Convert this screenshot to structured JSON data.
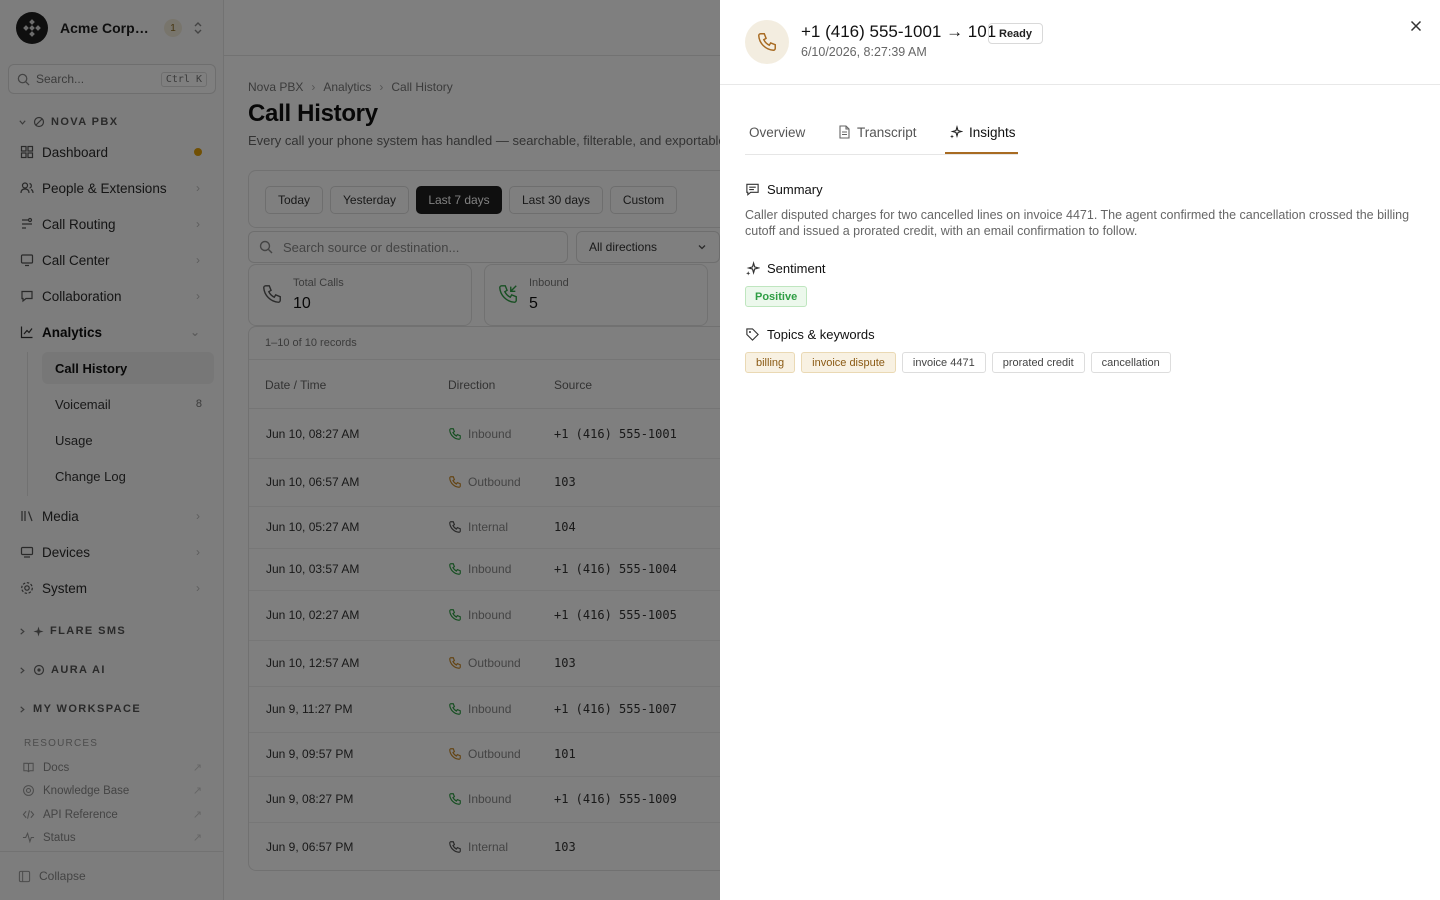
{
  "sidebar": {
    "org_name": "Acme Corporation",
    "org_badge": "1",
    "search_placeholder": "Search...",
    "search_shortcut": "Ctrl K",
    "section_nova": "NOVA PBX",
    "nav": {
      "dashboard": "Dashboard",
      "people": "People & Extensions",
      "routing": "Call Routing",
      "center": "Call Center",
      "collab": "Collaboration",
      "analytics": "Analytics",
      "media": "Media",
      "devices": "Devices",
      "system": "System"
    },
    "sub": {
      "history": "Call History",
      "voicemail": "Voicemail",
      "voicemail_count": "8",
      "usage": "Usage",
      "changelog": "Change Log"
    },
    "section_flare": "FLARE SMS",
    "section_aura": "AURA AI",
    "section_workspace": "MY WORKSPACE",
    "resources_head": "RESOURCES",
    "resources": {
      "docs": "Docs",
      "kb": "Knowledge Base",
      "api": "API Reference",
      "status": "Status"
    },
    "collapse": "Collapse"
  },
  "main": {
    "breadcrumb": [
      "Nova PBX",
      "Analytics",
      "Call History"
    ],
    "title": "Call History",
    "subtitle": "Every call your phone system has handled — searchable, filterable, and exportable.",
    "ranges": [
      "Today",
      "Yesterday",
      "Last 7 days",
      "Last 30 days",
      "Custom"
    ],
    "table_search_placeholder": "Search source or destination...",
    "direction_filter": "All directions",
    "stats": [
      {
        "label": "Total Calls",
        "value": "10"
      },
      {
        "label": "Inbound",
        "value": "5"
      }
    ],
    "records": "1–10 of 10 records",
    "columns": [
      "Date / Time",
      "Direction",
      "Source"
    ],
    "rows": [
      {
        "time": "Jun 10, 08:27 AM",
        "direction": "Inbound",
        "source": "+1 (416) 555-1001"
      },
      {
        "time": "Jun 10, 06:57 AM",
        "direction": "Outbound",
        "source": "103"
      },
      {
        "time": "Jun 10, 05:27 AM",
        "direction": "Internal",
        "source": "104"
      },
      {
        "time": "Jun 10, 03:57 AM",
        "direction": "Inbound",
        "source": "+1 (416) 555-1004"
      },
      {
        "time": "Jun 10, 02:27 AM",
        "direction": "Inbound",
        "source": "+1 (416) 555-1005"
      },
      {
        "time": "Jun 10, 12:57 AM",
        "direction": "Outbound",
        "source": "103"
      },
      {
        "time": "Jun 9, 11:27 PM",
        "direction": "Inbound",
        "source": "+1 (416) 555-1007"
      },
      {
        "time": "Jun 9, 09:57 PM",
        "direction": "Outbound",
        "source": "101"
      },
      {
        "time": "Jun 9, 08:27 PM",
        "direction": "Inbound",
        "source": "+1 (416) 555-1009"
      },
      {
        "time": "Jun 9, 06:57 PM",
        "direction": "Internal",
        "source": "103"
      }
    ]
  },
  "drawer": {
    "title": "+1 (416) 555-1001 → 101",
    "status": "Ready",
    "datetime": "6/10/2026, 8:27:39 AM",
    "tabs": {
      "overview": "Overview",
      "transcript": "Transcript",
      "insights": "Insights"
    },
    "summary_title": "Summary",
    "summary_text": "Caller disputed charges for two cancelled lines on invoice 4471. The agent confirmed the cancellation crossed the billing cutoff and issued a prorated credit, with an email confirmation to follow.",
    "sentiment_title": "Sentiment",
    "sentiment_value": "Positive",
    "topics_title": "Topics & keywords",
    "keywords": [
      "billing",
      "invoice dispute",
      "invoice 4471",
      "prorated credit",
      "cancellation"
    ]
  },
  "colors": {
    "accent": "#a86b22",
    "inbound": "#2f9e44",
    "outbound": "#c98a2a",
    "internal": "#555555",
    "positive": "#2f9e44"
  }
}
